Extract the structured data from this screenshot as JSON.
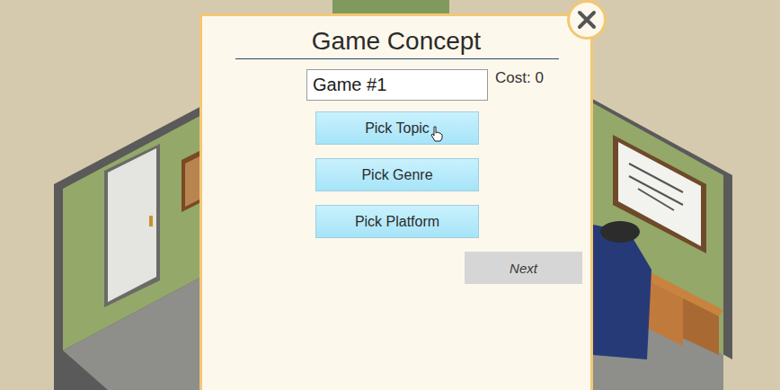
{
  "window": {
    "title": "Game Concept"
  },
  "name_field": {
    "value": "Game #1"
  },
  "cost": "Cost: 0",
  "buttons": [
    {
      "label": "Pick Topic",
      "hovered": true
    },
    {
      "label": "Pick Genre",
      "hovered": false
    },
    {
      "label": "Pick Platform",
      "hovered": false
    }
  ],
  "next_button": {
    "label": "Next",
    "disabled": true
  }
}
